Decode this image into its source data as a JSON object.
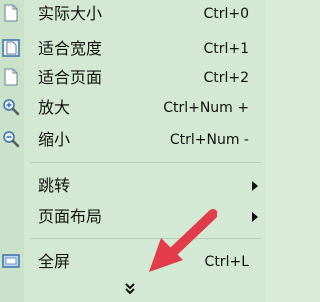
{
  "menu": {
    "items": [
      {
        "label": "实际大小",
        "shortcut": "Ctrl+0",
        "icon": "page-icon"
      },
      {
        "label": "适合宽度",
        "shortcut": "Ctrl+1",
        "icon": "fit-width-icon"
      },
      {
        "label": "适合页面",
        "shortcut": "Ctrl+2",
        "icon": "fit-page-icon"
      },
      {
        "label": "放大",
        "shortcut": "Ctrl+Num +",
        "icon": "zoom-in-icon"
      },
      {
        "label": "缩小",
        "shortcut": "Ctrl+Num -",
        "icon": "zoom-out-icon"
      },
      {
        "label": "跳转",
        "shortcut": "",
        "icon": ""
      },
      {
        "label": "页面布局",
        "shortcut": "",
        "icon": ""
      },
      {
        "label": "全屏",
        "shortcut": "Ctrl+L",
        "icon": "fullscreen-icon"
      }
    ]
  },
  "colors": {
    "menu_background": "#d3e9d3",
    "arrow": "#e23c4a"
  }
}
